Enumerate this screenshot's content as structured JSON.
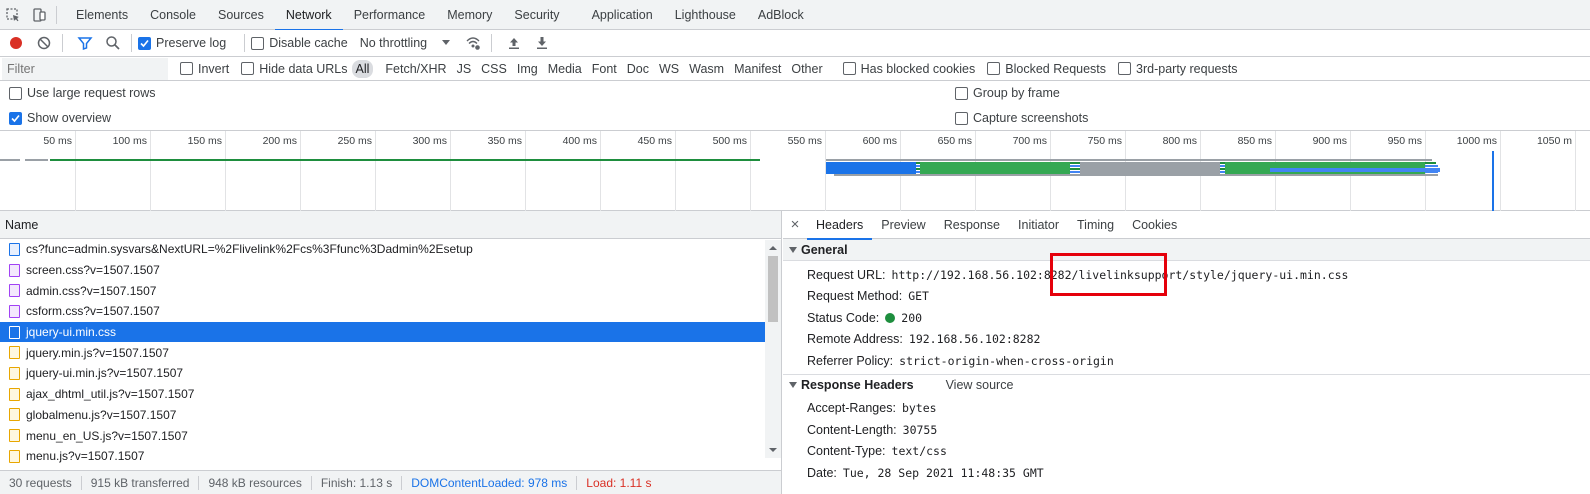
{
  "tabs": [
    "Elements",
    "Console",
    "Sources",
    "Network",
    "Performance",
    "Memory",
    "Security",
    "Application",
    "Lighthouse",
    "AdBlock"
  ],
  "active_tab": "Network",
  "toolbar": {
    "preserve_log": "Preserve log",
    "disable_cache": "Disable cache",
    "throttling": "No throttling"
  },
  "filterbar": {
    "placeholder": "Filter",
    "invert": "Invert",
    "hide_data_urls": "Hide data URLs",
    "types": [
      "All",
      "Fetch/XHR",
      "JS",
      "CSS",
      "Img",
      "Media",
      "Font",
      "Doc",
      "WS",
      "Wasm",
      "Manifest",
      "Other"
    ],
    "has_blocked_cookies": "Has blocked cookies",
    "blocked_requests": "Blocked Requests",
    "third_party": "3rd-party requests"
  },
  "options": {
    "large_rows": "Use large request rows",
    "show_overview": "Show overview",
    "group_by_frame": "Group by frame",
    "capture_screenshots": "Capture screenshots"
  },
  "overview": {
    "ticks": [
      "50 ms",
      "100 ms",
      "150 ms",
      "200 ms",
      "250 ms",
      "300 ms",
      "350 ms",
      "400 ms",
      "450 ms",
      "500 ms",
      "550 ms",
      "600 ms",
      "650 ms",
      "700 ms",
      "750 ms",
      "800 ms",
      "850 ms",
      "900 ms",
      "950 ms",
      "1000 ms",
      "1050 m"
    ]
  },
  "list": {
    "header": "Name",
    "requests": [
      {
        "name": "cs?func=admin.sysvars&NextURL=%2Flivelink%2Fcs%3Ffunc%3Dadmin%2Esetup",
        "type": "doc"
      },
      {
        "name": "screen.css?v=1507.1507",
        "type": "css"
      },
      {
        "name": "admin.css?v=1507.1507",
        "type": "css"
      },
      {
        "name": "csform.css?v=1507.1507",
        "type": "css"
      },
      {
        "name": "jquery-ui.min.css",
        "type": "css",
        "selected": true
      },
      {
        "name": "jquery.min.js?v=1507.1507",
        "type": "js"
      },
      {
        "name": "jquery-ui.min.js?v=1507.1507",
        "type": "js"
      },
      {
        "name": "ajax_dhtml_util.js?v=1507.1507",
        "type": "js"
      },
      {
        "name": "globalmenu.js?v=1507.1507",
        "type": "js"
      },
      {
        "name": "menu_en_US.js?v=1507.1507",
        "type": "js"
      },
      {
        "name": "menu.js?v=1507.1507",
        "type": "js"
      }
    ]
  },
  "status": {
    "requests": "30 requests",
    "transferred": "915 kB transferred",
    "resources": "948 kB resources",
    "finish": "Finish: 1.13 s",
    "dcl": "DOMContentLoaded: 978 ms",
    "load": "Load: 1.11 s"
  },
  "details": {
    "tabs": [
      "Headers",
      "Preview",
      "Response",
      "Initiator",
      "Timing",
      "Cookies"
    ],
    "general_title": "General",
    "general": [
      {
        "k": "Request URL:",
        "v": "http://192.168.56.102:8282/livelinksupport/style/jquery-ui.min.css"
      },
      {
        "k": "Request Method:",
        "v": "GET"
      },
      {
        "k": "Status Code:",
        "v": "200"
      },
      {
        "k": "Remote Address:",
        "v": "192.168.56.102:8282"
      },
      {
        "k": "Referrer Policy:",
        "v": "strict-origin-when-cross-origin"
      }
    ],
    "response_title": "Response Headers",
    "view_source": "View source",
    "response": [
      {
        "k": "Accept-Ranges:",
        "v": "bytes"
      },
      {
        "k": "Content-Length:",
        "v": "30755"
      },
      {
        "k": "Content-Type:",
        "v": "text/css"
      },
      {
        "k": "Date:",
        "v": "Tue, 28 Sep 2021 11:48:35 GMT"
      }
    ]
  },
  "colors": {
    "accent": "#1a73e8",
    "record": "#d93025",
    "highlight": "#e5000b"
  }
}
